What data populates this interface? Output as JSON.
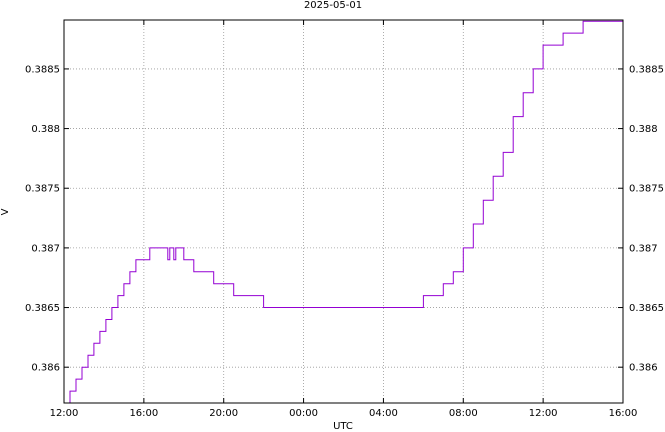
{
  "chart_data": {
    "type": "line",
    "title": "2025-05-01",
    "xlabel": "UTC",
    "ylabel": "V",
    "x_ticks": [
      "12:00",
      "16:00",
      "20:00",
      "00:00",
      "04:00",
      "08:00",
      "12:00",
      "16:00"
    ],
    "x_tick_hours": [
      0,
      4,
      8,
      12,
      16,
      20,
      24,
      28
    ],
    "xlim_hours": [
      0,
      28
    ],
    "y_ticks": [
      "0.386",
      "0.3865",
      "0.387",
      "0.3875",
      "0.388",
      "0.3885"
    ],
    "y_tick_values": [
      0.386,
      0.3865,
      0.387,
      0.3875,
      0.388,
      0.3885
    ],
    "ylim": [
      0.3857,
      0.38891
    ],
    "grid": true,
    "line_color": "#9400d3",
    "series": [
      {
        "x_hours": [
          0.0,
          0.3,
          0.6,
          0.9,
          1.2,
          1.5,
          1.8,
          2.1,
          2.4,
          2.7,
          3.0,
          3.3,
          3.4,
          3.6,
          3.7,
          4.0,
          4.3,
          4.4,
          4.6,
          4.8,
          5.0,
          5.2,
          5.3,
          5.5,
          5.6,
          5.8,
          6.0,
          6.2,
          6.5,
          7.0,
          7.5,
          8.0,
          8.5,
          9.0,
          9.5,
          10.0,
          10.5,
          11.0,
          11.5,
          12.0,
          13.0,
          14.0,
          15.0,
          16.0,
          17.0,
          18.0,
          18.5,
          19.0,
          19.5,
          20.0,
          20.5,
          21.0,
          21.5,
          22.0,
          22.5,
          23.0,
          23.5,
          24.0,
          25.0,
          26.0,
          27.0,
          28.0
        ],
        "values": [
          0.3857,
          0.3858,
          0.3859,
          0.386,
          0.3861,
          0.3862,
          0.3863,
          0.3864,
          0.3865,
          0.3866,
          0.3867,
          0.3868,
          0.3868,
          0.3869,
          0.3869,
          0.3869,
          0.387,
          0.387,
          0.387,
          0.387,
          0.387,
          0.3869,
          0.387,
          0.3869,
          0.387,
          0.387,
          0.3869,
          0.3869,
          0.3868,
          0.3868,
          0.3867,
          0.3867,
          0.3866,
          0.3866,
          0.3866,
          0.3865,
          0.3865,
          0.3865,
          0.3865,
          0.3865,
          0.3865,
          0.3865,
          0.3865,
          0.3865,
          0.3865,
          0.3866,
          0.3866,
          0.3867,
          0.3868,
          0.387,
          0.3872,
          0.3874,
          0.3876,
          0.3878,
          0.3881,
          0.3883,
          0.3885,
          0.3887,
          0.3888,
          0.3889,
          0.3889,
          0.3889
        ]
      }
    ]
  }
}
